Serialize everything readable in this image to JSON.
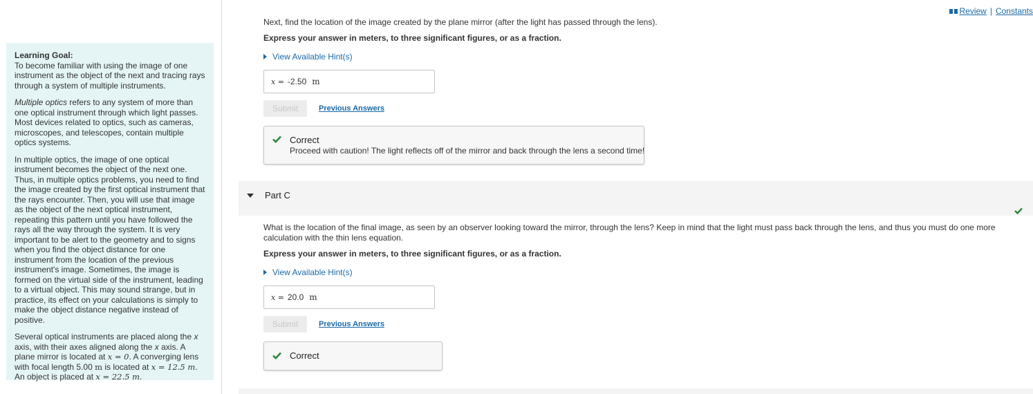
{
  "header": {
    "review_label": "Review",
    "separator": "|",
    "constants_label": "Constants"
  },
  "left_panel": {
    "title": "Learning Goal:",
    "goal": "To become familiar with using the image of one instrument as the object of the next and tracing rays through a system of multiple instruments.",
    "p1_em": "Multiple optics",
    "p1_rest": " refers to any system of more than one optical instrument through which light passes. Most devices related to optics, such as cameras, microscopes, and telescopes, contain multiple optics systems.",
    "p2": "In multiple optics, the image of one optical instrument becomes the object of the next one. Thus, in multiple optics problems, you need to find the image created by the first optical instrument that the rays encounter. Then, you will use that image as the object of the next optical instrument, repeating this pattern until you have followed the rays all the way through the system. It is very important to be alert to the geometry and to signs when you find the object distance for one instrument from the location of the previous instrument's image. Sometimes, the image is formed on the virtual side of the instrument, leading to a virtual object. This may sound strange, but in practice, its effect on your calculations is simply to make the object distance negative instead of positive.",
    "p3_a": "Several optical instruments are placed along the ",
    "p3_x1": "x",
    "p3_b": " axis, with their axes aligned along the ",
    "p3_x2": "x",
    "p3_c": " axis. A plane mirror is located at ",
    "p3_m1": "x = 0",
    "p3_d": ". A converging lens with focal length 5.00 ",
    "p3_m_unit": "m",
    "p3_e": " is located at ",
    "p3_m2": "x = 12.5 m",
    "p3_f": ". An object is placed at ",
    "p3_m3": "x = 22.5 m",
    "p3_g": "."
  },
  "part_b": {
    "question": "Next, find the location of the image created by the plane mirror (after the light has passed through the lens).",
    "instruction": "Express your answer in meters, to three significant figures, or as a fraction.",
    "hint_label": "View Available Hint(s)",
    "var_label": "x =",
    "answer_value": "-2.50",
    "unit": "m",
    "submit_label": "Submit",
    "prev_answers_label": "Previous Answers",
    "feedback_title": "Correct",
    "feedback_message": "Proceed with caution! The light reflects off of the mirror and back through the lens a second time!"
  },
  "part_c": {
    "label": "Part C",
    "question": "What is the location of the final image, as seen by an observer looking toward the mirror, through the lens? Keep in mind that the light must pass back through the lens, and thus you must do one more calculation with the thin lens equation.",
    "instruction": "Express your answer in meters, to three significant figures, or as a fraction.",
    "hint_label": "View Available Hint(s)",
    "var_label": "x =",
    "answer_value": "20.0",
    "unit": "m",
    "submit_label": "Submit",
    "prev_answers_label": "Previous Answers",
    "feedback_title": "Correct"
  },
  "colors": {
    "link": "#1a6aa8",
    "correct_check": "#2e8540",
    "panel_bg": "#e5f5f5"
  }
}
